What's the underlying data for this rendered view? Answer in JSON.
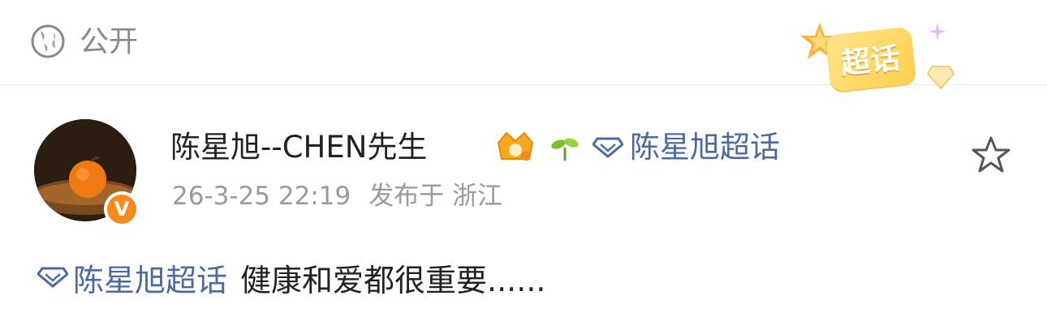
{
  "visibility": {
    "icon": "globe-icon",
    "label": "公开"
  },
  "badge": {
    "label": "超话",
    "icons": [
      "star-icon",
      "sparkle-icon",
      "gem-icon"
    ]
  },
  "post": {
    "author": {
      "name": "陈星旭--CHEN先生",
      "avatar": "avatar-orange-photo",
      "verified_icon": "verified-v-icon",
      "verified_mark": "V",
      "level_icons": [
        "crown-badge-icon",
        "sprout-icon"
      ]
    },
    "super_topic": {
      "icon": "diamond-icon",
      "label": "陈星旭超话"
    },
    "timestamp": "26-3-25 22:19",
    "location": "发布于 浙江",
    "content": {
      "topic": {
        "icon": "diamond-icon",
        "label": "陈星旭超话"
      },
      "text": "健康和爱都很重要......"
    },
    "favorite_icon": "star-outline-icon"
  },
  "colors": {
    "link": "#4a6aa0",
    "text": "#222222",
    "muted": "#9a9a9a",
    "verified": "#f48b1a",
    "badge": "#ffd15a"
  }
}
